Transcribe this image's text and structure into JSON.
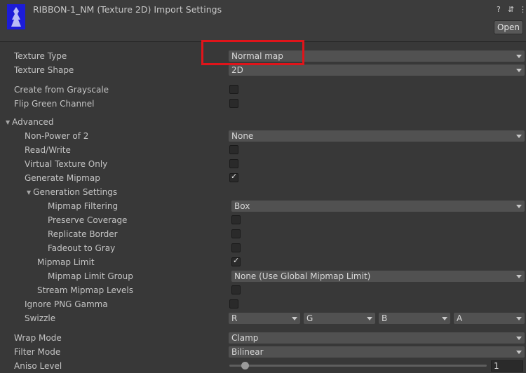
{
  "header": {
    "title": "RIBBON-1_NM (Texture 2D) Import Settings",
    "open_label": "Open",
    "help_icon": "?",
    "preset_icon": "⇵",
    "menu_icon": "⋮"
  },
  "fields": {
    "texture_type": {
      "label": "Texture Type",
      "value": "Normal map"
    },
    "texture_shape": {
      "label": "Texture Shape",
      "value": "2D"
    },
    "create_from_grayscale": {
      "label": "Create from Grayscale",
      "checked": false
    },
    "flip_green": {
      "label": "Flip Green Channel",
      "checked": false
    },
    "advanced": {
      "label": "Advanced"
    },
    "non_power_of_2": {
      "label": "Non-Power of 2",
      "value": "None"
    },
    "read_write": {
      "label": "Read/Write",
      "checked": false
    },
    "virtual_texture": {
      "label": "Virtual Texture Only",
      "checked": false
    },
    "generate_mipmap": {
      "label": "Generate Mipmap",
      "checked": true
    },
    "generation_settings": {
      "label": "Generation Settings"
    },
    "mipmap_filtering": {
      "label": "Mipmap Filtering",
      "value": "Box"
    },
    "preserve_coverage": {
      "label": "Preserve Coverage",
      "checked": false
    },
    "replicate_border": {
      "label": "Replicate Border",
      "checked": false
    },
    "fadeout_to_gray": {
      "label": "Fadeout to Gray",
      "checked": false
    },
    "mipmap_limit": {
      "label": "Mipmap Limit",
      "checked": true
    },
    "mipmap_limit_group": {
      "label": "Mipmap Limit Group",
      "value": "None (Use Global Mipmap Limit)"
    },
    "stream_mipmap_levels": {
      "label": "Stream Mipmap Levels",
      "checked": false
    },
    "ignore_png_gamma": {
      "label": "Ignore PNG Gamma",
      "checked": false
    },
    "swizzle": {
      "label": "Swizzle",
      "r": "R",
      "g": "G",
      "b": "B",
      "a": "A"
    },
    "wrap_mode": {
      "label": "Wrap Mode",
      "value": "Clamp"
    },
    "filter_mode": {
      "label": "Filter Mode",
      "value": "Bilinear"
    },
    "aniso_level": {
      "label": "Aniso Level",
      "value": "1",
      "slider_fraction": 0.06
    }
  },
  "colors": {
    "highlight": "#e0141a",
    "thumbnail": "#1c1cd8"
  }
}
